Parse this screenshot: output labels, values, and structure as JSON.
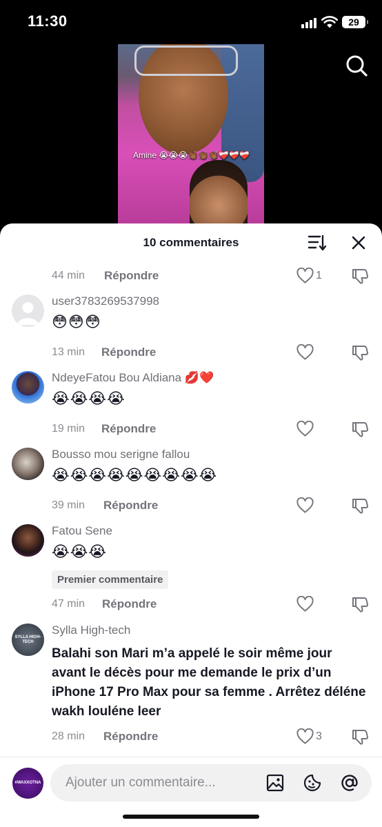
{
  "status_bar": {
    "time": "11:30",
    "battery": "29"
  },
  "video": {
    "caption": "Amine 😭😭😭👏🏾👏🏾👏🏾❤️‍🩹❤️‍🩹❤️‍🩹"
  },
  "sheet": {
    "title": "10 commentaires"
  },
  "labels": {
    "reply": "Répondre"
  },
  "comments": [
    {
      "username": "",
      "text": "",
      "time": "44 min",
      "likes": "1"
    },
    {
      "username": "user3783269537998",
      "text": "😳😳😳",
      "time": "13 min",
      "likes": ""
    },
    {
      "username": "NdeyeFatou Bou Aldiana 💋❤️",
      "text": "😭😭😭😭",
      "time": "19 min",
      "likes": ""
    },
    {
      "username": "Bousso mou serigne fallou",
      "text": "😭😭😭😭😭😭😭😭😭",
      "time": "39 min",
      "likes": ""
    },
    {
      "username": "Fatou Sene",
      "text": "😭😭😭",
      "time": "47 min",
      "likes": "",
      "badge": "Premier commentaire"
    },
    {
      "username": "Sylla High-tech",
      "text": "Balahi son Mari m’a appelé le soir même jour avant le décès pour me demande le prix d’un iPhone 17 Pro Max pour sa femme . Arrêtez déléne wakh louléne leer",
      "time": "28 min",
      "likes": "3",
      "avatar_text": "SYLLA HIGH-TECH"
    }
  ],
  "composer": {
    "placeholder": "Ajouter un commentaire...",
    "avatar_text": "#WAXXOTNA"
  },
  "colors": {
    "sheet_bg": "#ffffff",
    "muted_text": "#8a8b91",
    "accent_pink": "#d94fb8"
  },
  "icons": [
    "search-icon",
    "sort-icon",
    "close-icon",
    "heart-icon",
    "dislike-icon",
    "image-icon",
    "emoji-icon",
    "mention-icon"
  ]
}
